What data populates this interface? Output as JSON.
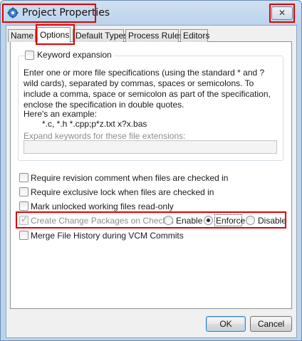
{
  "window": {
    "title": "Project Properties",
    "close_glyph": "✕",
    "icon": "gear-icon"
  },
  "tabs": [
    {
      "label": "Name"
    },
    {
      "label": "Options"
    },
    {
      "label": "Default Types"
    },
    {
      "label": "Process Rules"
    },
    {
      "label": "Editors"
    }
  ],
  "keyword_expansion": {
    "label": "Keyword expansion",
    "checked": false,
    "description": "Enter one or more file specifications (using the standard * and ? wild cards), separated by commas, spaces or semicolons.  To include a comma, space or semicolon as part of the specification, enclose the specification in double quotes.",
    "example_label": "Here's an example:",
    "example": "*.c, *.h *.cpp;p*z.txt x?x.bas",
    "extensions_label": "Expand keywords for these file extensions:",
    "extensions_value": ""
  },
  "options": {
    "require_comment": "Require revision comment when files are checked in",
    "require_lock": "Require exclusive lock when files are checked in",
    "mark_readonly": "Mark unlocked working files read-only",
    "change_packages": "Create Change Packages on Checkin",
    "merge_history": "Merge File History during VCM Commits"
  },
  "change_packages_mode": {
    "options": [
      "Enable",
      "Enforce",
      "Disable"
    ],
    "selected": "Enforce"
  },
  "buttons": {
    "ok": "OK",
    "cancel": "Cancel"
  },
  "colors": {
    "highlight": "#e00000",
    "title_bar": "#bcd3ec"
  }
}
